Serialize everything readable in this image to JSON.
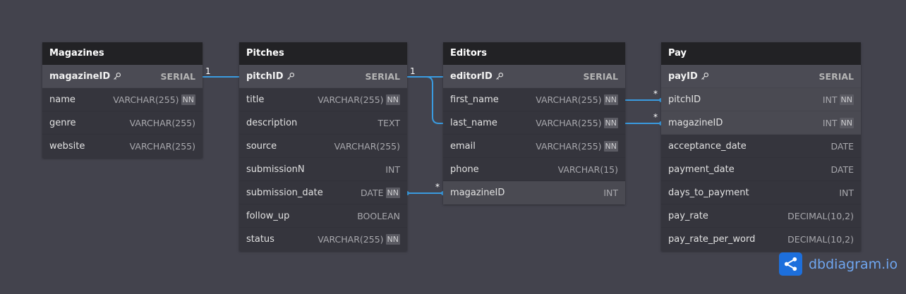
{
  "tables": [
    {
      "name": "Magazines",
      "fields": [
        {
          "name": "magazineID",
          "type": "SERIAL",
          "pk": true
        },
        {
          "name": "name",
          "type": "VARCHAR(255)",
          "nn": true
        },
        {
          "name": "genre",
          "type": "VARCHAR(255)"
        },
        {
          "name": "website",
          "type": "VARCHAR(255)"
        }
      ]
    },
    {
      "name": "Pitches",
      "fields": [
        {
          "name": "pitchID",
          "type": "SERIAL",
          "pk": true
        },
        {
          "name": "title",
          "type": "VARCHAR(255)",
          "nn": true
        },
        {
          "name": "description",
          "type": "TEXT"
        },
        {
          "name": "source",
          "type": "VARCHAR(255)"
        },
        {
          "name": "submissionN",
          "type": "INT"
        },
        {
          "name": "submission_date",
          "type": "DATE",
          "nn": true
        },
        {
          "name": "follow_up",
          "type": "BOOLEAN"
        },
        {
          "name": "status",
          "type": "VARCHAR(255)",
          "nn": true
        }
      ]
    },
    {
      "name": "Editors",
      "fields": [
        {
          "name": "editorID",
          "type": "SERIAL",
          "pk": true
        },
        {
          "name": "first_name",
          "type": "VARCHAR(255)",
          "nn": true
        },
        {
          "name": "last_name",
          "type": "VARCHAR(255)",
          "nn": true
        },
        {
          "name": "email",
          "type": "VARCHAR(255)",
          "nn": true
        },
        {
          "name": "phone",
          "type": "VARCHAR(15)"
        },
        {
          "name": "magazineID",
          "type": "INT",
          "highlight": true
        }
      ]
    },
    {
      "name": "Pay",
      "fields": [
        {
          "name": "payID",
          "type": "SERIAL",
          "pk": true
        },
        {
          "name": "pitchID",
          "type": "INT",
          "nn": true,
          "highlight": true
        },
        {
          "name": "magazineID",
          "type": "INT",
          "nn": true,
          "highlight": true
        },
        {
          "name": "acceptance_date",
          "type": "DATE"
        },
        {
          "name": "payment_date",
          "type": "DATE"
        },
        {
          "name": "days_to_payment",
          "type": "INT"
        },
        {
          "name": "pay_rate",
          "type": "DECIMAL(10,2)"
        },
        {
          "name": "pay_rate_per_word",
          "type": "DECIMAL(10,2)"
        }
      ]
    }
  ],
  "nn_label": "NN",
  "cardinality": {
    "one": "1",
    "many": "*"
  },
  "brand": {
    "text": "dbdiagram.io"
  },
  "colors": {
    "background": "#43434d",
    "header": "#222225",
    "link": "#3a9be0",
    "brand": "#1d6fdc"
  },
  "icons": {
    "primary_key": "key-icon",
    "brand_logo": "share-nodes-icon"
  }
}
